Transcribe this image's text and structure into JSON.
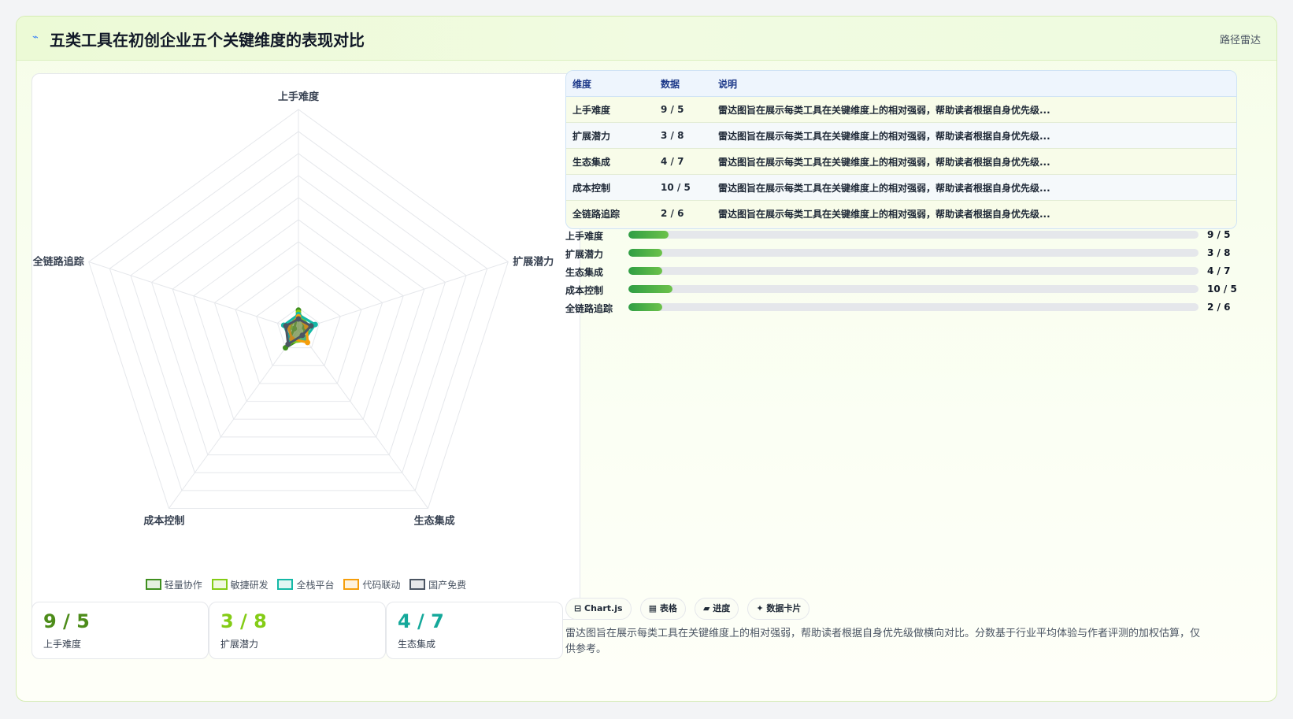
{
  "header": {
    "title": "五类工具在初创企业五个关键维度的表现对比",
    "tag": "路径雷达"
  },
  "chart_data": {
    "type": "radar",
    "axes": [
      "上手难度",
      "扩展潜力",
      "生态集成",
      "成本控制",
      "全链路追踪"
    ],
    "rmax": 100,
    "grid_levels": 10,
    "series": [
      {
        "name": "轻量协作",
        "values": [
          9,
          3,
          4,
          10,
          2
        ],
        "color": "#3f8f1f"
      },
      {
        "name": "敏捷研发",
        "values": [
          8,
          5,
          6,
          7,
          4
        ],
        "color": "#84cc16"
      },
      {
        "name": "全栈平台",
        "values": [
          7,
          8,
          5,
          6,
          7
        ],
        "color": "#14b8a6"
      },
      {
        "name": "代码联动",
        "values": [
          6,
          4,
          7,
          5,
          5
        ],
        "color": "#f59e0b"
      },
      {
        "name": "国产免费",
        "values": [
          5,
          6,
          3,
          8,
          6
        ],
        "color": "#4b5563"
      }
    ]
  },
  "legend": [
    {
      "label": "轻量协作",
      "color": "#3f8f1f"
    },
    {
      "label": "敏捷研发",
      "color": "#84cc16"
    },
    {
      "label": "全栈平台",
      "color": "#14b8a6"
    },
    {
      "label": "代码联动",
      "color": "#f59e0b"
    },
    {
      "label": "国产免费",
      "color": "#4b5563"
    }
  ],
  "stats": [
    {
      "value": "9 / 5",
      "label": "上手难度",
      "color": "#4d8c1a"
    },
    {
      "value": "3 / 8",
      "label": "扩展潜力",
      "color": "#84cc16"
    },
    {
      "value": "4 / 7",
      "label": "生态集成",
      "color": "#14a89a"
    }
  ],
  "table": {
    "headers": [
      "维度",
      "数据",
      "说明"
    ],
    "rows": [
      [
        "上手难度",
        "9 / 5",
        "雷达图旨在展示每类工具在关键维度上的相对强弱，帮助读者根据自身优先级..."
      ],
      [
        "扩展潜力",
        "3 / 8",
        "雷达图旨在展示每类工具在关键维度上的相对强弱，帮助读者根据自身优先级..."
      ],
      [
        "生态集成",
        "4 / 7",
        "雷达图旨在展示每类工具在关键维度上的相对强弱，帮助读者根据自身优先级..."
      ],
      [
        "成本控制",
        "10 / 5",
        "雷达图旨在展示每类工具在关键维度上的相对强弱，帮助读者根据自身优先级..."
      ],
      [
        "全链路追踪",
        "2 / 6",
        "雷达图旨在展示每类工具在关键维度上的相对强弱，帮助读者根据自身优先级..."
      ]
    ]
  },
  "progress": [
    {
      "label": "上手难度",
      "value": "9 / 5",
      "fraction": 0.07
    },
    {
      "label": "扩展潜力",
      "value": "3 / 8",
      "fraction": 0.06
    },
    {
      "label": "生态集成",
      "value": "4 / 7",
      "fraction": 0.06
    },
    {
      "label": "成本控制",
      "value": "10 / 5",
      "fraction": 0.078
    },
    {
      "label": "全链路追踪",
      "value": "2 / 6",
      "fraction": 0.06
    }
  ],
  "chips": [
    "⊟ Chart.js",
    "▦ 表格",
    "▰ 进度",
    "✦ 数据卡片"
  ],
  "footnote": "雷达图旨在展示每类工具在关键维度上的相对强弱，帮助读者根据自身优先级做横向对比。分数基于行业平均体验与作者评测的加权估算，仅供参考。"
}
